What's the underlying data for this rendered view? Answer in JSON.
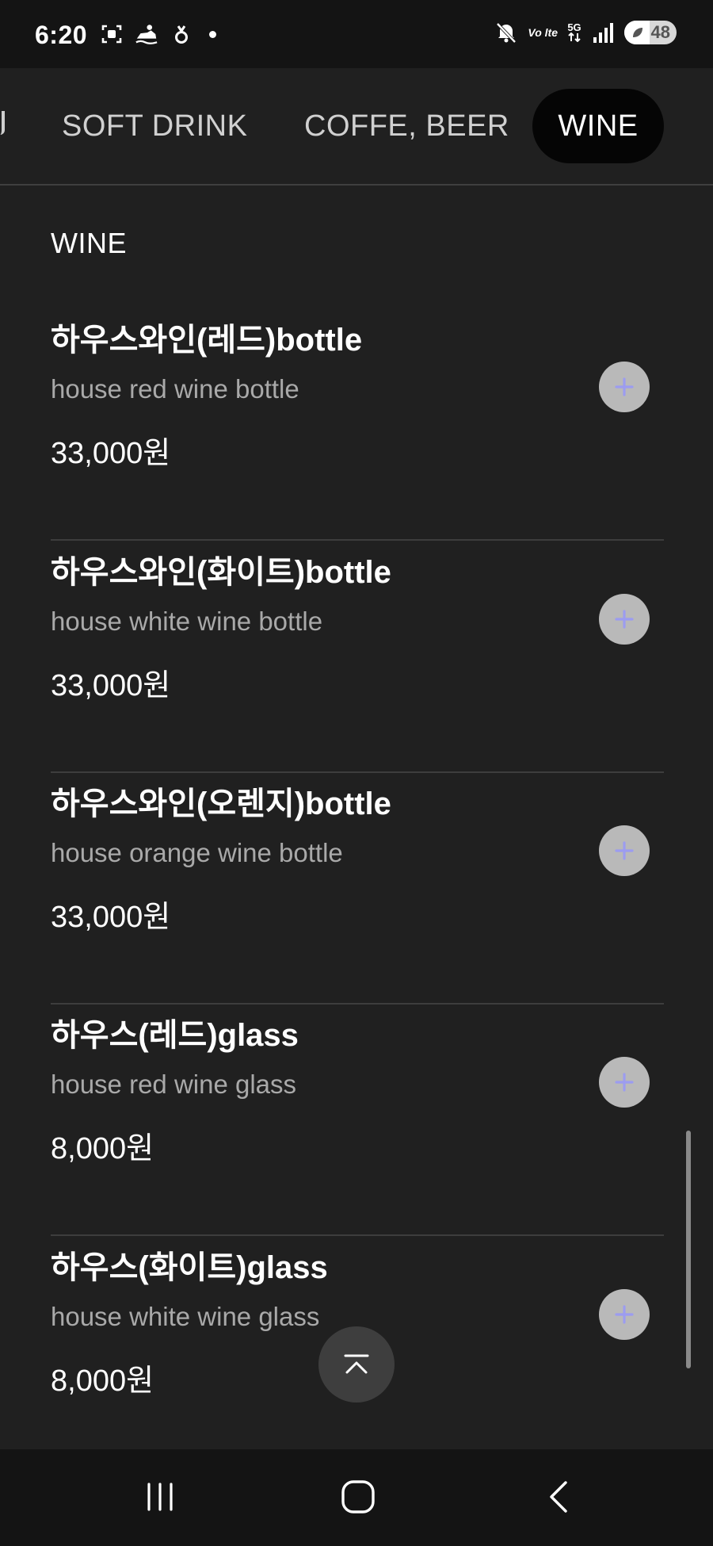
{
  "status_bar": {
    "time": "6:20",
    "network": "5G",
    "volte": "Vo lte",
    "battery": "48",
    "icons": [
      "screenshot-icon",
      "jetski-icon",
      "notification-icon",
      "dot-icon",
      "mute-icon",
      "signal-icon",
      "battery-icon"
    ]
  },
  "tabs": [
    {
      "label": "SOFT DRINK",
      "selected": false
    },
    {
      "label": "COFFE, BEER",
      "selected": false
    },
    {
      "label": "WINE",
      "selected": true
    }
  ],
  "section": {
    "title": "WINE"
  },
  "items": [
    {
      "name": "하우스와인(레드)bottle",
      "description": "house red wine bottle",
      "price": "33,000원"
    },
    {
      "name": "하우스와인(화이트)bottle",
      "description": "house white wine bottle",
      "price": "33,000원"
    },
    {
      "name": "하우스와인(오렌지)bottle",
      "description": "house orange wine bottle",
      "price": "33,000원"
    },
    {
      "name": "하우스(레드)glass",
      "description": "house red wine glass",
      "price": "8,000원"
    },
    {
      "name": "하우스(화이트)glass",
      "description": "house white wine glass",
      "price": "8,000원"
    }
  ],
  "colors": {
    "background": "#202020",
    "add_button": "#b9b9b9",
    "plus_icon": "#9c9cf0",
    "selected_tab": "#050505"
  }
}
